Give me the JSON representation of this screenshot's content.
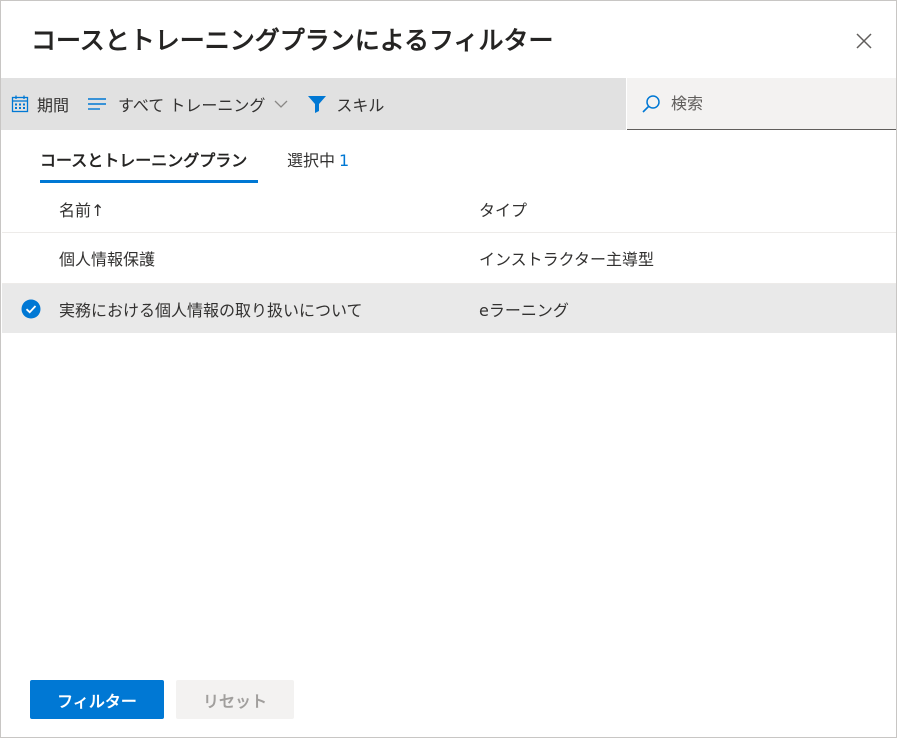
{
  "dialog": {
    "title": "コースとトレーニングプランによるフィルター"
  },
  "toolbar": {
    "period_label": "期間",
    "type_filter_label": "すべて トレーニング",
    "skill_label": "スキル"
  },
  "search": {
    "placeholder": "検索"
  },
  "tabs": [
    {
      "label": "コースとトレーニングプラン"
    },
    {
      "label": "選択中",
      "count": "1"
    }
  ],
  "table": {
    "columns": [
      {
        "label": "名前↑"
      },
      {
        "label": "タイプ"
      }
    ],
    "rows": [
      {
        "name": "個人情報保護",
        "type": "インストラクター主導型",
        "selected": false
      },
      {
        "name": "実務における個人情報の取り扱いについて",
        "type": "eラーニング",
        "selected": true
      }
    ]
  },
  "buttons": {
    "filter": "フィルター",
    "reset": "リセット"
  },
  "colors": {
    "accent": "#0078d4",
    "toolbar_bg": "#e1e1e1",
    "selected_row_bg": "#e9e9e9"
  },
  "icons": [
    "close-icon",
    "calendar-icon",
    "list-icon",
    "chevron-down-icon",
    "filter-funnel-icon",
    "search-icon",
    "checkmark-circle-icon"
  ]
}
